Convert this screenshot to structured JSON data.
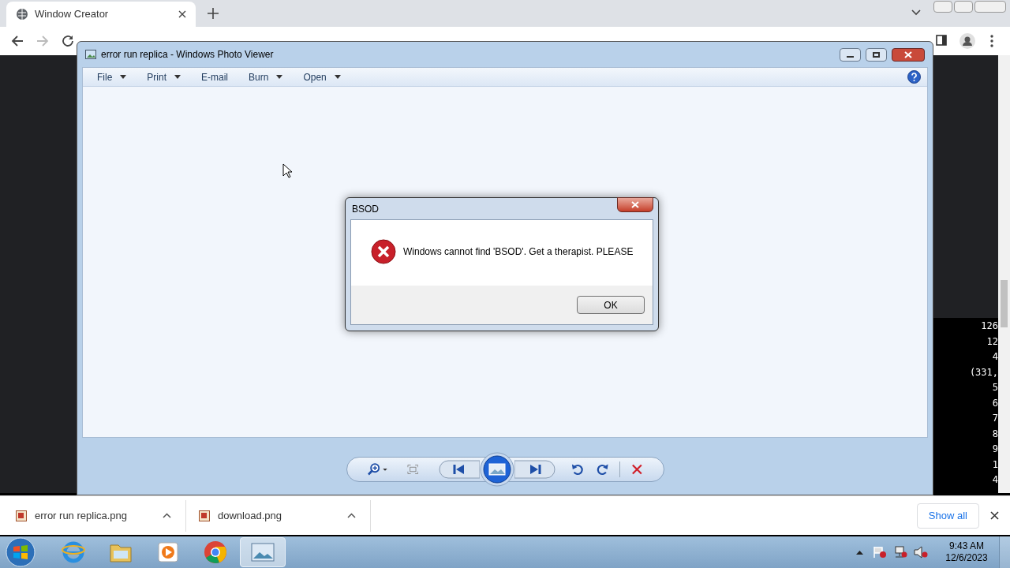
{
  "browser": {
    "tab_title": "Window Creator"
  },
  "console_lines": [
    "126",
    "12",
    "4",
    "(331,",
    "5",
    "6",
    "7",
    "8",
    "9",
    "1",
    "4"
  ],
  "photo_viewer": {
    "title": "error run replica - Windows Photo Viewer",
    "menu": [
      {
        "label": "File",
        "dropdown": true
      },
      {
        "label": "Print",
        "dropdown": true
      },
      {
        "label": "E-mail",
        "dropdown": false
      },
      {
        "label": "Burn",
        "dropdown": true
      },
      {
        "label": "Open",
        "dropdown": true
      }
    ]
  },
  "dialog": {
    "title": "BSOD",
    "message": "Windows cannot find 'BSOD'. Get a therapist. PLEASE",
    "button": "OK"
  },
  "downloads": {
    "items": [
      {
        "name": "error run replica.png"
      },
      {
        "name": "download.png"
      }
    ],
    "show_all": "Show all"
  },
  "taskbar": {
    "apps": [
      {
        "kind": "ie",
        "selected": false
      },
      {
        "kind": "folder",
        "selected": false
      },
      {
        "kind": "media",
        "selected": false
      },
      {
        "kind": "chrome",
        "selected": false
      },
      {
        "kind": "photo",
        "selected": true
      }
    ],
    "time": "9:43 AM",
    "date": "12/6/2023"
  }
}
